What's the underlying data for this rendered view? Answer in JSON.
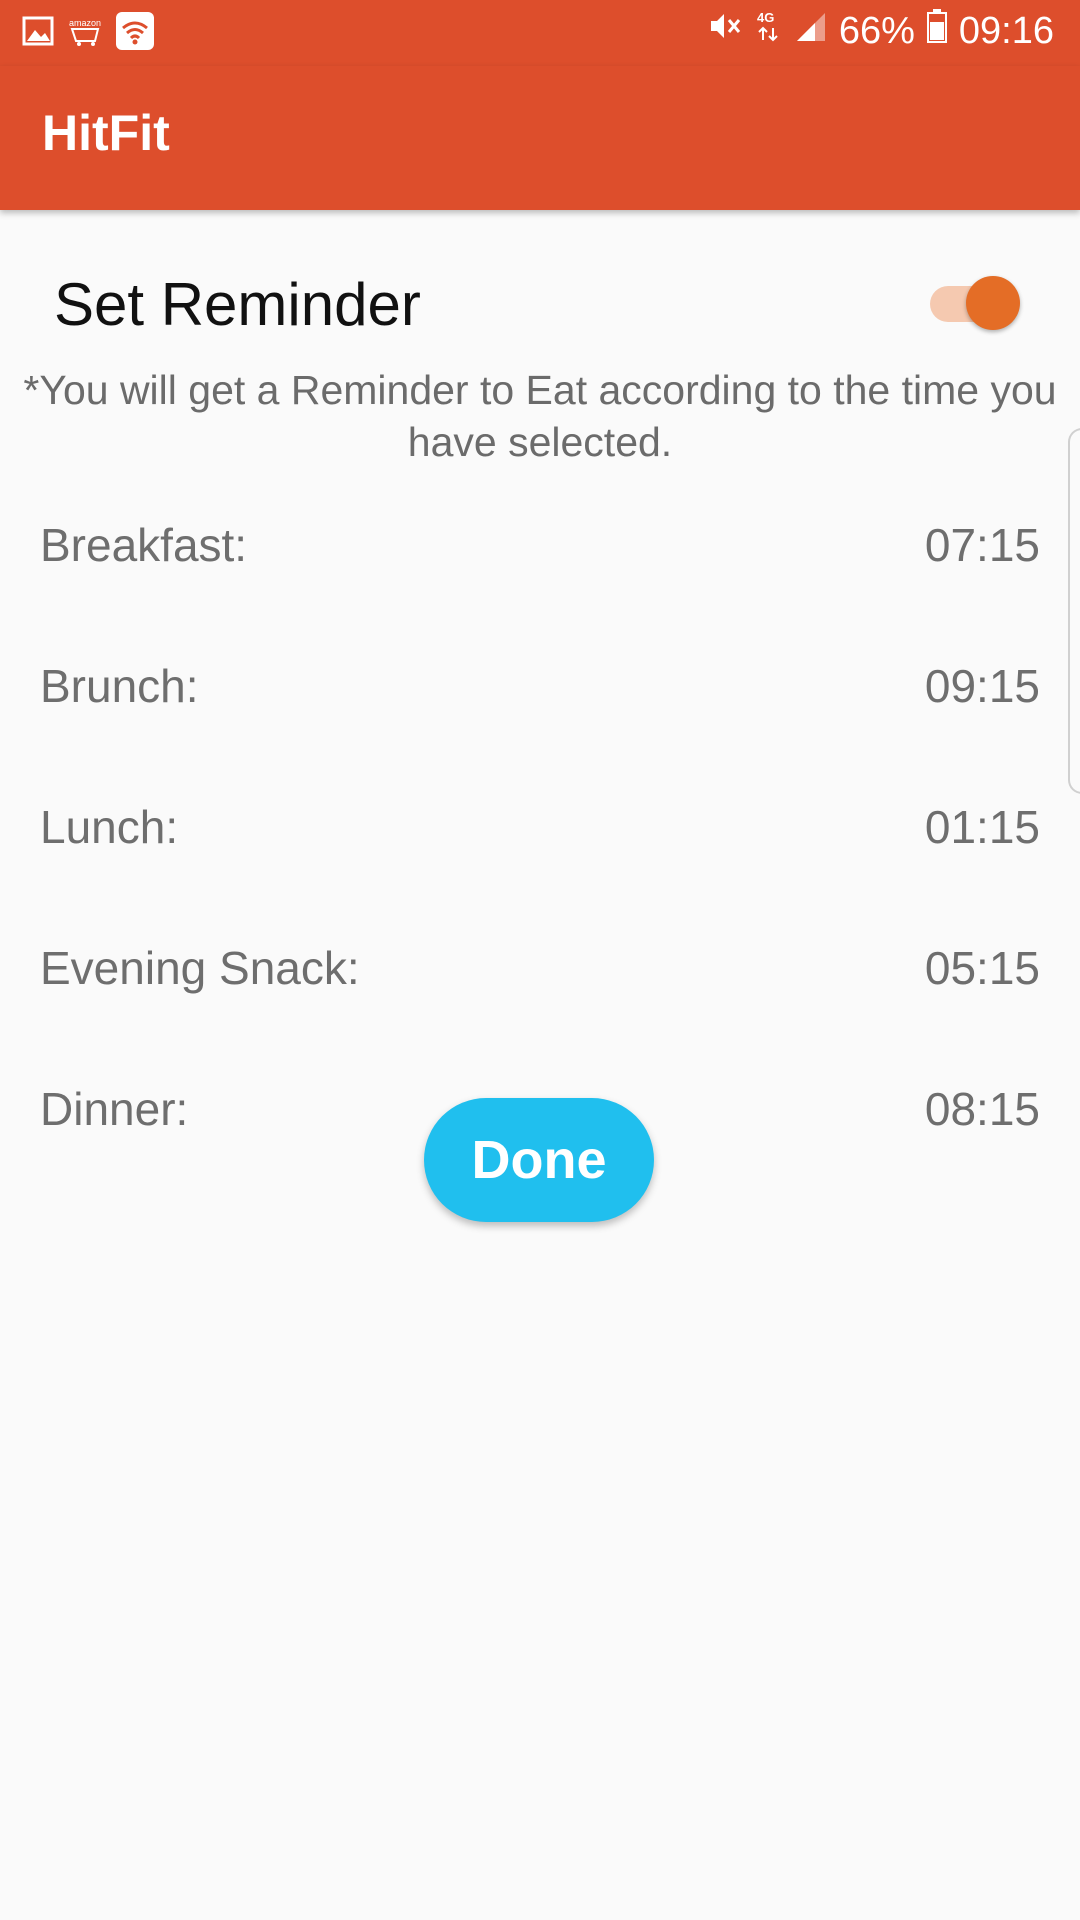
{
  "status_bar": {
    "battery_percent": "66%",
    "time": "09:16",
    "network": "4G",
    "icons": [
      "gallery-icon",
      "amazon-icon",
      "wifi-icon",
      "mute-icon",
      "network-4g-icon",
      "signal-icon",
      "battery-icon"
    ]
  },
  "app": {
    "title": "HitFit",
    "accent": "#dd4e2c"
  },
  "reminder": {
    "title": "Set Reminder",
    "enabled": true,
    "note": "*You will get a Reminder to Eat according to the time you have selected."
  },
  "meals": [
    {
      "label": "Breakfast:",
      "time": "07:15"
    },
    {
      "label": "Brunch:",
      "time": "09:15"
    },
    {
      "label": "Lunch:",
      "time": "01:15"
    },
    {
      "label": "Evening Snack:",
      "time": "05:15"
    },
    {
      "label": "Dinner:",
      "time": "08:15"
    }
  ],
  "done_button": {
    "label": "Done",
    "color": "#20bfee"
  }
}
